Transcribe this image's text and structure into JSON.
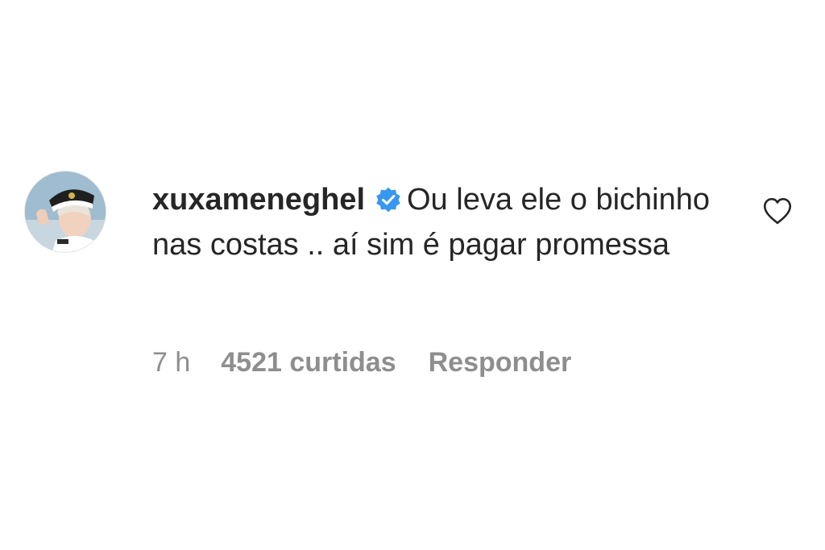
{
  "comment": {
    "username": "xuxameneghel",
    "verified": true,
    "text": "Ou leva ele o bichinho nas costas .. aí sim é pagar promessa",
    "time": "7 h",
    "likes": "4521 curtidas",
    "reply_label": "Responder",
    "icons": {
      "verified": "verified-badge-icon",
      "like": "heart-outline-icon"
    }
  },
  "colors": {
    "text": "#262626",
    "secondary": "#8e8e8e",
    "verified": "#3897f0",
    "background": "#ffffff"
  }
}
